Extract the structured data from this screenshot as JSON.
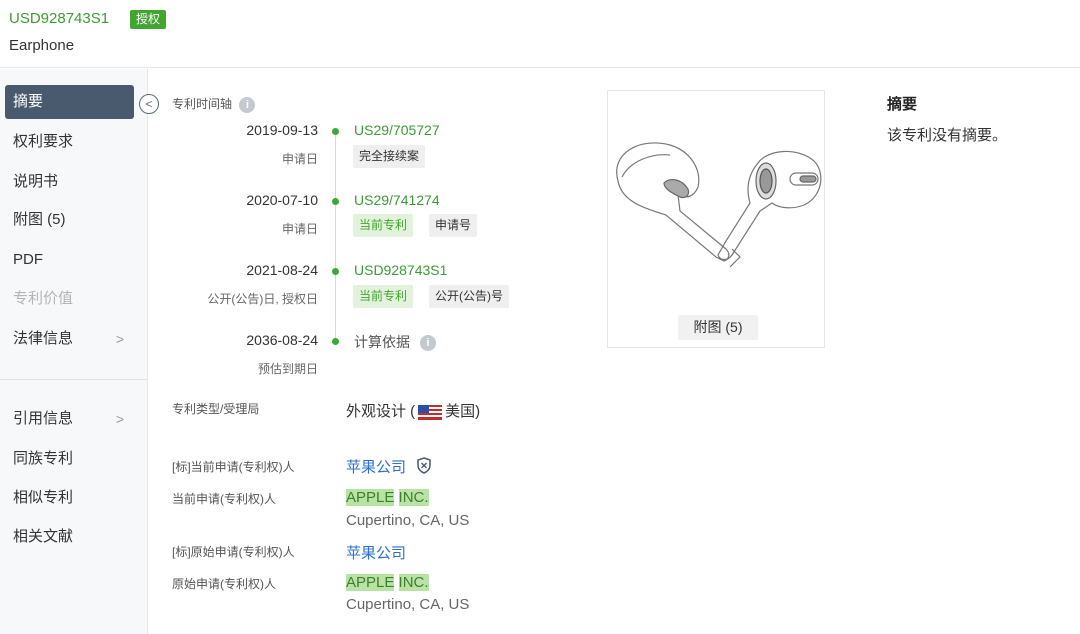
{
  "header": {
    "patent_number": "USD928743S1",
    "status_badge": "授权",
    "title": "Earphone"
  },
  "sidebar": {
    "items": [
      {
        "label": "摘要",
        "active": true
      },
      {
        "label": "权利要求"
      },
      {
        "label": "说明书"
      },
      {
        "label": "附图 (5)"
      },
      {
        "label": "PDF"
      },
      {
        "label": "专利价值",
        "disabled": true
      },
      {
        "label": "法律信息",
        "arrow": ">"
      },
      {
        "label": "引用信息",
        "arrow": ">"
      },
      {
        "label": "同族专利"
      },
      {
        "label": "相似专利"
      },
      {
        "label": "相关文献"
      }
    ],
    "collapse_icon": "<"
  },
  "timeline": {
    "heading": "专利时间轴",
    "info_icon": "i",
    "events": [
      {
        "date": "2019-09-13",
        "sub": "申请日",
        "number": "US29/705727",
        "tags": [
          {
            "label": "完全接续案",
            "style": "grey"
          }
        ]
      },
      {
        "date": "2020-07-10",
        "sub": "申请日",
        "number": "US29/741274",
        "tags": [
          {
            "label": "当前专利",
            "style": "green"
          },
          {
            "label": "申请号",
            "style": "grey"
          }
        ]
      },
      {
        "date": "2021-08-24",
        "sub": "公开(公告)日, 授权日",
        "number": "USD928743S1",
        "tags": [
          {
            "label": "当前专利",
            "style": "green"
          },
          {
            "label": "公开(公告)号",
            "style": "grey"
          }
        ]
      },
      {
        "date": "2036-08-24",
        "sub": "预估到期日",
        "number": "计算依据",
        "tags": []
      }
    ]
  },
  "figure": {
    "button_label": "附图 (5)"
  },
  "abstract": {
    "title": "摘要",
    "text": "该专利没有摘要。"
  },
  "info": {
    "type_label": "专利类型/受理局",
    "type_value": "外观设计 (",
    "type_country": "美国)",
    "std_current_applicant_label": "[标]当前申请(专利权)人",
    "std_current_applicant_value": "苹果公司",
    "current_applicant_label": "当前申请(专利权)人",
    "current_applicant_word1": "APPLE",
    "current_applicant_word2": "INC.",
    "current_applicant_address": "Cupertino, CA, US",
    "std_original_applicant_label": "[标]原始申请(专利权)人",
    "std_original_applicant_value": "苹果公司",
    "original_applicant_label": "原始申请(专利权)人",
    "original_applicant_word1": "APPLE",
    "original_applicant_word2": "INC.",
    "original_applicant_address": "Cupertino, CA, US"
  },
  "colors": {
    "accent_green": "#3d9b35",
    "badge_green": "#41a62f",
    "link_blue": "#2f6fd0",
    "sidebar_active": "#4a5a6e"
  },
  "icons": [
    "chevron-left-icon",
    "info-icon",
    "us-flag-icon",
    "shield-icon",
    "chevron-right-icon"
  ]
}
